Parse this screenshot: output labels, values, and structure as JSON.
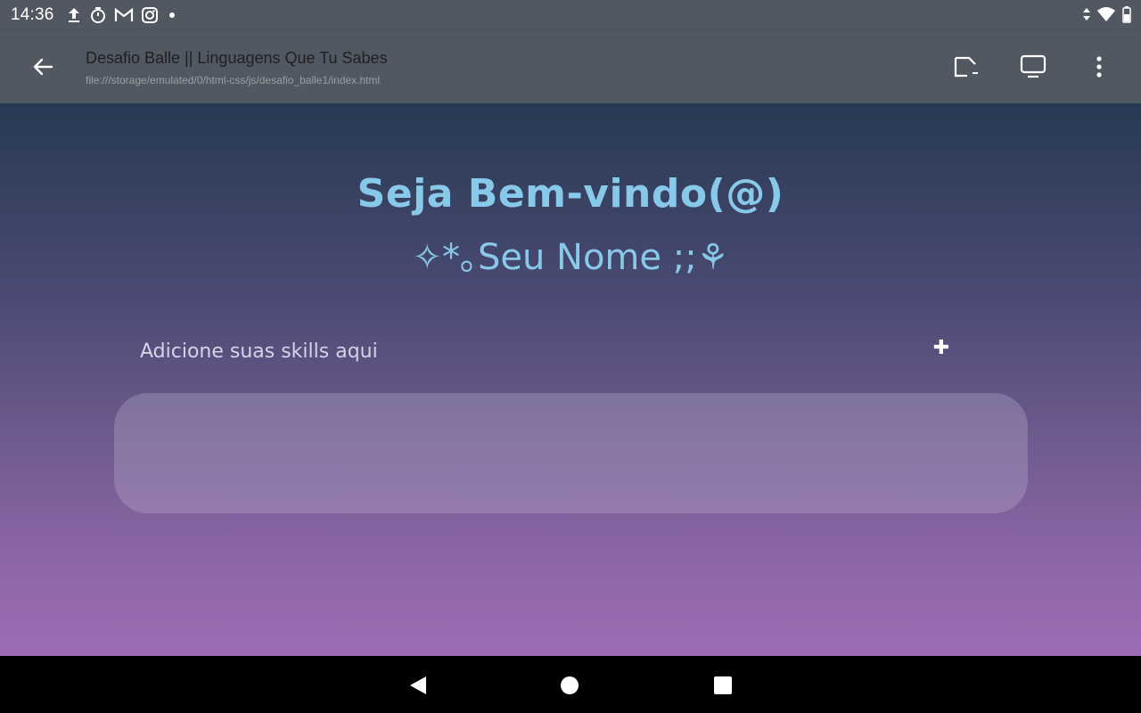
{
  "status_bar": {
    "time": "14:36",
    "left_icons": [
      "upload-icon",
      "timer-icon",
      "gmail-icon",
      "instagram-icon",
      "dot-icon"
    ],
    "right_icons": [
      "data-arrows-icon",
      "wifi-icon",
      "battery-icon"
    ]
  },
  "app_bar": {
    "title": "Desafio Balle || Linguagens Que Tu Sabes",
    "url": "file:///storage/emulated/0/html-css/js/desafio_balle1/index.html",
    "actions": [
      "console-icon",
      "desktop-mode-icon",
      "more-vert-icon"
    ]
  },
  "page": {
    "welcome": "Seja Bem-vindo(@)",
    "username": "✧*｡Seu Nome ;;⚘",
    "skill_input": {
      "placeholder": "Adicione suas skills aqui",
      "value": ""
    },
    "add_button": "✚"
  },
  "colors": {
    "bar_bg": "#525861",
    "heading": "#88c8e8",
    "gradient_top": "#273a52",
    "gradient_bottom": "#9d6cb3"
  },
  "nav_bar": [
    "back-icon",
    "home-icon",
    "recents-icon"
  ]
}
